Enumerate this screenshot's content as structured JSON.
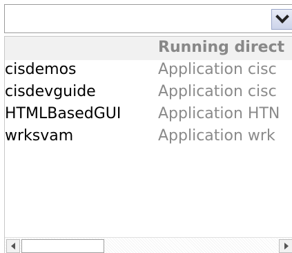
{
  "combo": {
    "value": "",
    "button_icon": "chevron-down-icon"
  },
  "table": {
    "columns": [
      "",
      "Running direct"
    ],
    "rows": [
      {
        "name": "cisdemos",
        "dir": "Application cisc"
      },
      {
        "name": "cisdevguide",
        "dir": "Application cisc"
      },
      {
        "name": "HTMLBasedGUI",
        "dir": "Application HTN"
      },
      {
        "name": "wrksvam",
        "dir": "Application wrk"
      }
    ]
  },
  "scrollbar": {
    "left_icon": "arrow-left-icon",
    "right_icon": "arrow-right-icon"
  }
}
